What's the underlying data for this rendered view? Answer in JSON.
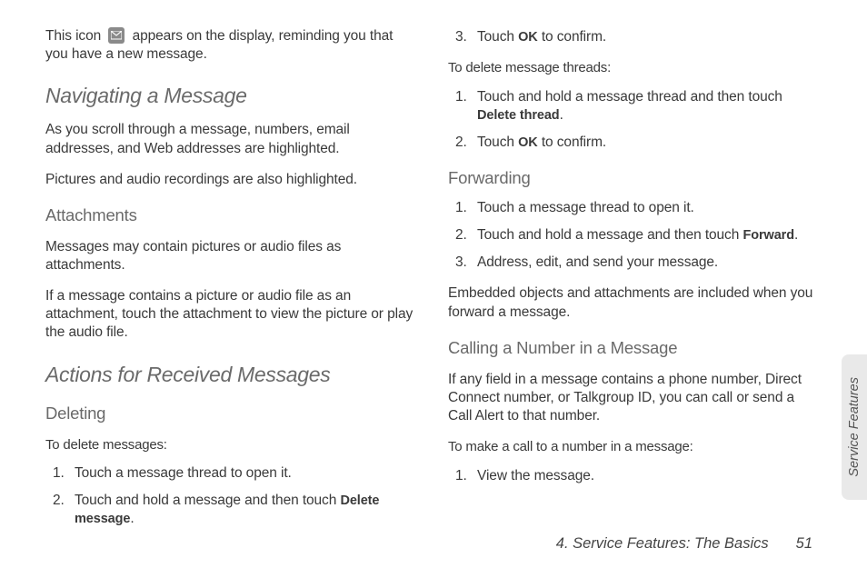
{
  "col1": {
    "intro_a": "This icon",
    "intro_b": "appears on the display, reminding you that you have a new message.",
    "h_nav": "Navigating a Message",
    "p_nav1": "As you scroll through a message, numbers, email addresses, and Web addresses are highlighted.",
    "p_nav2": "Pictures and audio recordings are also highlighted.",
    "h_attach": "Attachments",
    "p_attach1": "Messages may contain pictures or audio files as attachments.",
    "p_attach2": "If a message contains a picture or audio file as an attachment, touch the attachment to view the picture or play the audio file.",
    "h_actions": "Actions for Received Messages",
    "h_deleting": "Deleting",
    "lead_del": "To delete messages:",
    "del_s1": "Touch a message thread to open it.",
    "del_s2_a": "Touch and hold a message and then touch ",
    "del_s2_b": "Delete message",
    "del_s2_c": "."
  },
  "col2": {
    "del_s3_a": "Touch ",
    "del_s3_b": "OK",
    "del_s3_c": " to confirm.",
    "lead_threads": "To delete message threads:",
    "thr_s1_a": "Touch and hold a message thread and then touch ",
    "thr_s1_b": "Delete thread",
    "thr_s1_c": ".",
    "thr_s2_a": "Touch ",
    "thr_s2_b": "OK",
    "thr_s2_c": " to confirm.",
    "h_fwd": "Forwarding",
    "fwd_s1": "Touch a message thread to open it.",
    "fwd_s2_a": "Touch and hold a message and then touch ",
    "fwd_s2_b": "Forward",
    "fwd_s2_c": ".",
    "fwd_s3": "Address, edit, and send your message.",
    "p_fwd_note": "Embedded objects and attachments are included when you forward a message.",
    "h_call": "Calling a Number in a Message",
    "p_call": "If any field in a message contains a phone number, Direct Connect number, or Talkgroup ID, you can call or send a Call Alert to that number.",
    "lead_call": "To make a call to a number in a message:",
    "call_s1": "View the message."
  },
  "footer": {
    "chapter": "4. Service Features: The Basics",
    "page": "51"
  },
  "tab": "Service Features"
}
